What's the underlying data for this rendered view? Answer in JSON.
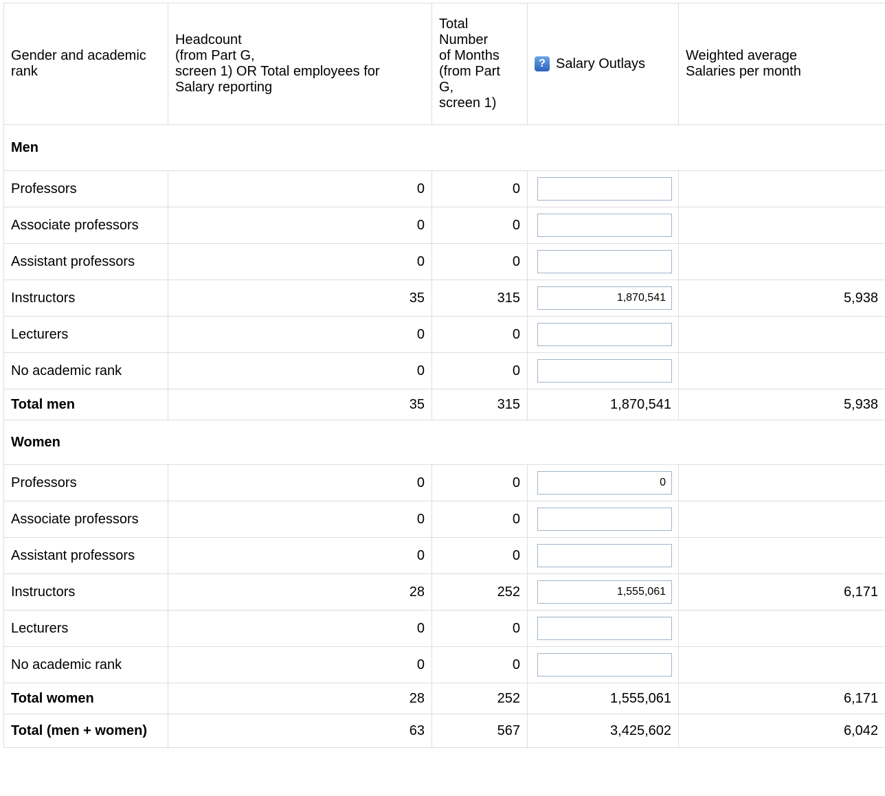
{
  "header": {
    "col1": "Gender and academic rank",
    "col2_lines": [
      "Headcount",
      "(from Part G,",
      "screen 1) OR Total employees for",
      "Salary reporting"
    ],
    "col3_lines": [
      "Total",
      "Number",
      "of Months",
      "(from Part",
      "G,",
      "screen 1)"
    ],
    "col4": "Salary Outlays",
    "col4_icon": "question-mark-icon",
    "col5_lines": [
      "Weighted average",
      "Salaries per month"
    ]
  },
  "men": {
    "section_label": "Men",
    "rows": [
      {
        "rank": "Professors",
        "headcount": "0",
        "months": "0",
        "salary": "",
        "avg": ""
      },
      {
        "rank": "Associate professors",
        "headcount": "0",
        "months": "0",
        "salary": "",
        "avg": ""
      },
      {
        "rank": "Assistant professors",
        "headcount": "0",
        "months": "0",
        "salary": "",
        "avg": ""
      },
      {
        "rank": "Instructors",
        "headcount": "35",
        "months": "315",
        "salary": "1,870,541",
        "avg": "5,938"
      },
      {
        "rank": "Lecturers",
        "headcount": "0",
        "months": "0",
        "salary": "",
        "avg": ""
      },
      {
        "rank": "No academic rank",
        "headcount": "0",
        "months": "0",
        "salary": "",
        "avg": ""
      }
    ],
    "total": {
      "label": "Total men",
      "headcount": "35",
      "months": "315",
      "salary": "1,870,541",
      "avg": "5,938"
    }
  },
  "women": {
    "section_label": "Women",
    "rows": [
      {
        "rank": "Professors",
        "headcount": "0",
        "months": "0",
        "salary": "0",
        "avg": ""
      },
      {
        "rank": "Associate professors",
        "headcount": "0",
        "months": "0",
        "salary": "",
        "avg": ""
      },
      {
        "rank": "Assistant professors",
        "headcount": "0",
        "months": "0",
        "salary": "",
        "avg": ""
      },
      {
        "rank": "Instructors",
        "headcount": "28",
        "months": "252",
        "salary": "1,555,061",
        "avg": "6,171"
      },
      {
        "rank": "Lecturers",
        "headcount": "0",
        "months": "0",
        "salary": "",
        "avg": ""
      },
      {
        "rank": "No academic rank",
        "headcount": "0",
        "months": "0",
        "salary": "",
        "avg": ""
      }
    ],
    "total": {
      "label": "Total women",
      "headcount": "28",
      "months": "252",
      "salary": "1,555,061",
      "avg": "6,171"
    }
  },
  "grand_total": {
    "label": "Total (men + women)",
    "headcount": "63",
    "months": "567",
    "salary": "3,425,602",
    "avg": "6,042"
  }
}
